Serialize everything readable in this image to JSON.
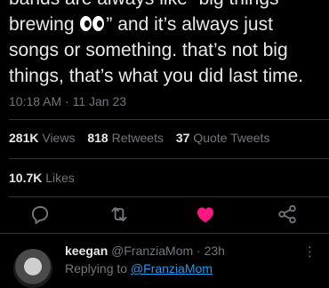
{
  "tweet": {
    "text_lines": [
      "bands are always like “big things",
      "brewing",
      "” and it’s always just",
      "songs or something. that’s not big",
      "things, that’s what you did last time."
    ],
    "timestamp": "10:18 AM · 11 Jan 23"
  },
  "stats": {
    "views_count": "281K",
    "views_label": "Views",
    "retweets_count": "818",
    "retweets_label": "Retweets",
    "quotes_count": "37",
    "quotes_label": "Quote Tweets",
    "likes_count": "10.7K",
    "likes_label": "Likes"
  },
  "actions": {
    "reply_icon": "reply-icon",
    "retweet_icon": "retweet-icon",
    "like_icon": "heart-icon",
    "share_icon": "share-icon",
    "like_color": "#f91880"
  },
  "reply": {
    "name": "keegan",
    "handle": "@FranziaMom · 23h",
    "more": "⋮",
    "replying_prefix": "Replying to ",
    "replying_mention": "@FranziaMom"
  },
  "colors": {
    "background": "#000000",
    "text": "#e7e9ea",
    "muted": "#71767b",
    "accent": "#1d9bf0"
  }
}
